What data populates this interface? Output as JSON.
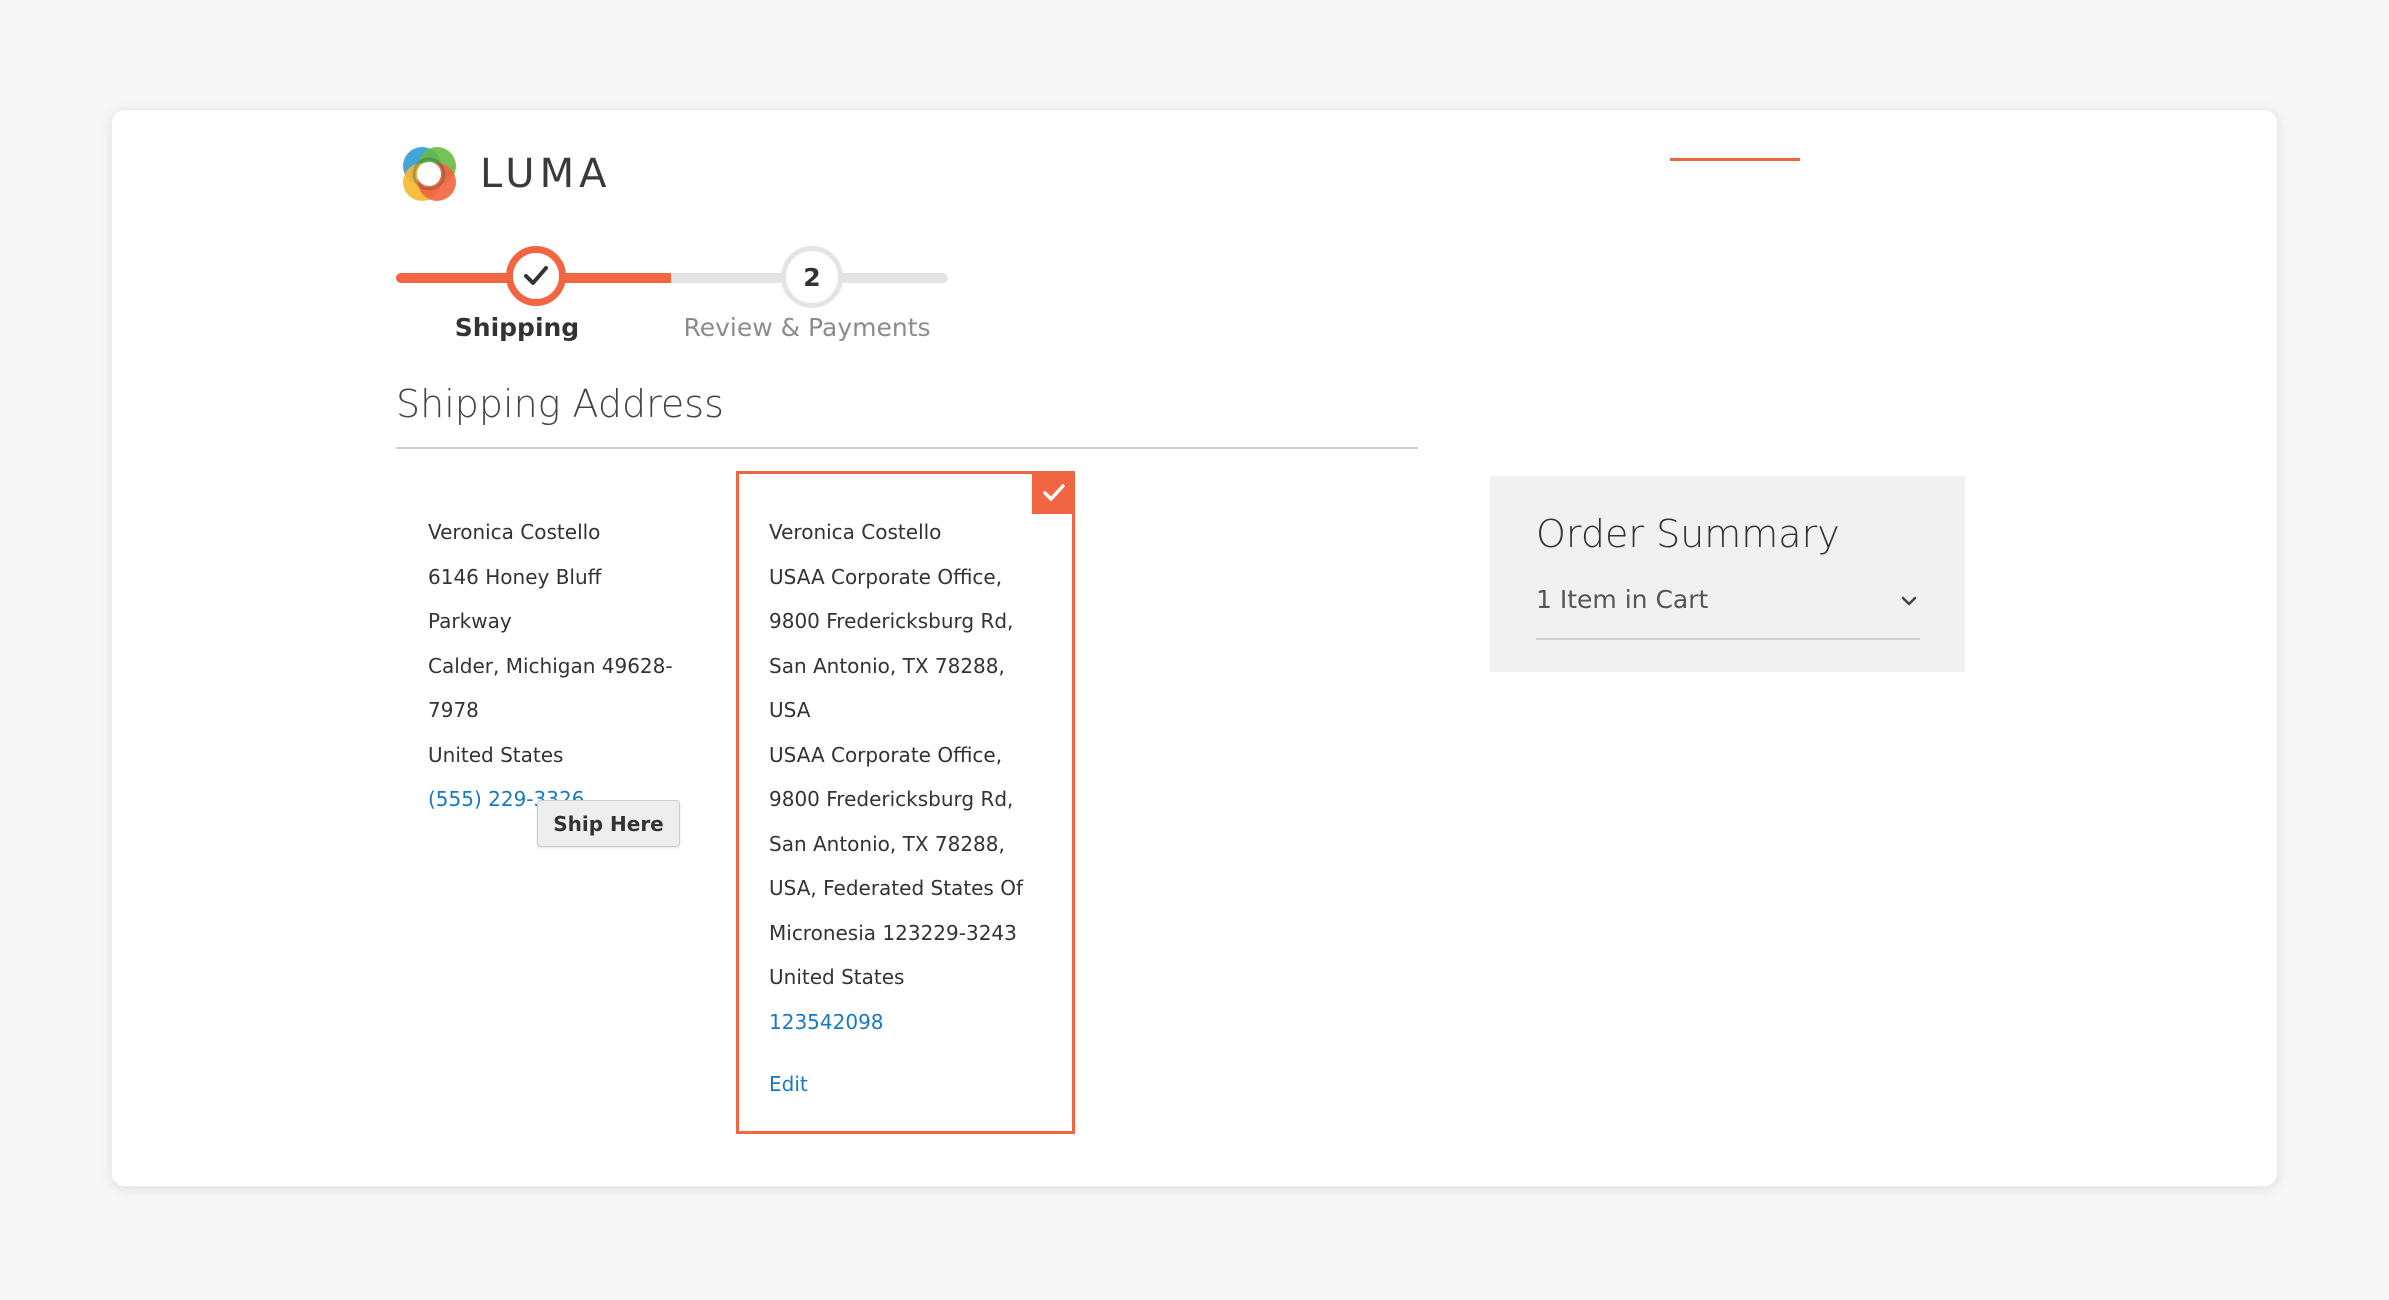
{
  "brand": {
    "name": "LUMA",
    "accent_color": "#f26542",
    "link_color": "#1979c3"
  },
  "progress": {
    "steps": [
      {
        "number": "1",
        "label": "Shipping",
        "state": "complete",
        "icon": "check-icon"
      },
      {
        "number": "2",
        "label": "Review & Payments",
        "state": "pending"
      }
    ]
  },
  "shipping": {
    "title": "Shipping Address",
    "addresses": [
      {
        "lines": [
          "Veronica Costello",
          "6146 Honey Bluff Parkway",
          "Calder, Michigan 49628-",
          "7978",
          "United States"
        ],
        "phone": "(555) 229-3326",
        "ship_here_label": "Ship Here",
        "selected": false
      },
      {
        "lines": [
          "Veronica Costello",
          "USAA Corporate Office,",
          "9800 Fredericksburg Rd,",
          "San Antonio, TX 78288,",
          "USA",
          "USAA Corporate Office,",
          "9800 Fredericksburg Rd,",
          "San Antonio, TX 78288,",
          "USA, Federated States Of",
          "Micronesia 123229-3243",
          "United States"
        ],
        "phone": "123542098",
        "edit_label": "Edit",
        "selected": true
      }
    ]
  },
  "order_summary": {
    "title": "Order Summary",
    "items_label": "1 Item in Cart"
  }
}
